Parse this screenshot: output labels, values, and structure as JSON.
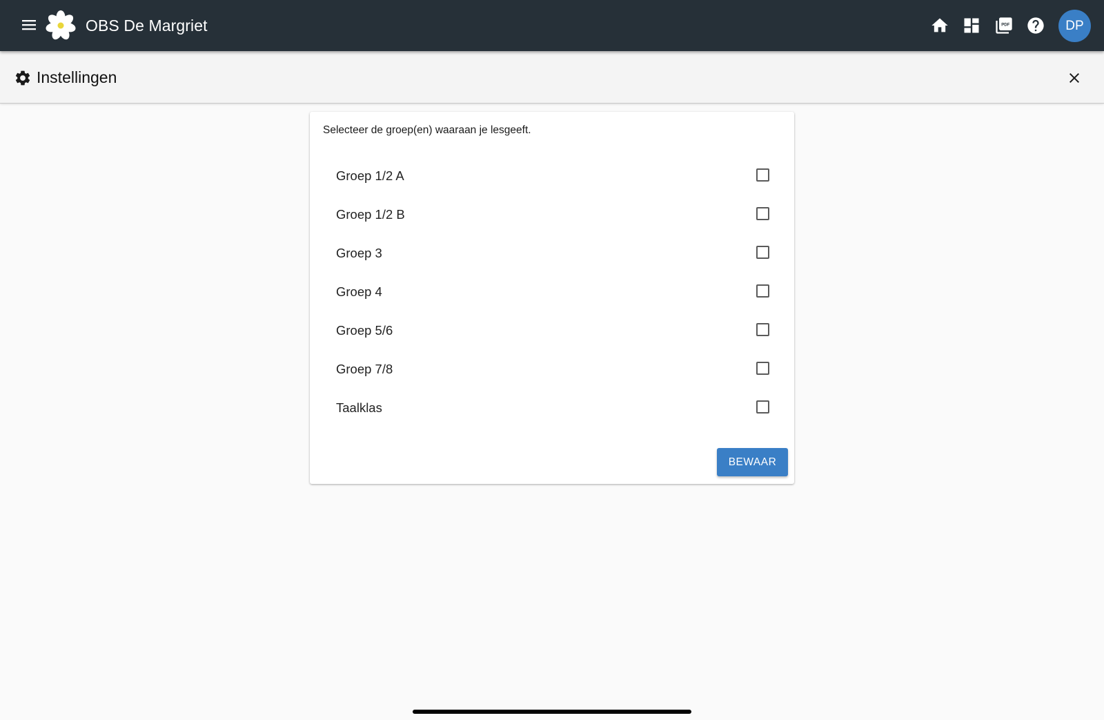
{
  "app": {
    "title": "OBS De Margriet",
    "brand_color": "#263038",
    "accent_color": "#3a7fc6"
  },
  "toolbar": {
    "icons": [
      "home-icon",
      "dashboard-icon",
      "pdf-icon",
      "help-icon"
    ],
    "avatar_initials": "DP"
  },
  "page": {
    "title": "Instellingen",
    "icon": "gear-icon"
  },
  "form": {
    "intro": "Selecteer de groep(en) waaraan je lesgeeft.",
    "groups": [
      {
        "label": "Groep 1/2 A",
        "checked": false
      },
      {
        "label": "Groep 1/2 B",
        "checked": false
      },
      {
        "label": "Groep 3",
        "checked": false
      },
      {
        "label": "Groep 4",
        "checked": false
      },
      {
        "label": "Groep 5/6",
        "checked": false
      },
      {
        "label": "Groep 7/8",
        "checked": false
      },
      {
        "label": "Taalklas",
        "checked": false
      }
    ],
    "save_label": "BEWAAR"
  }
}
